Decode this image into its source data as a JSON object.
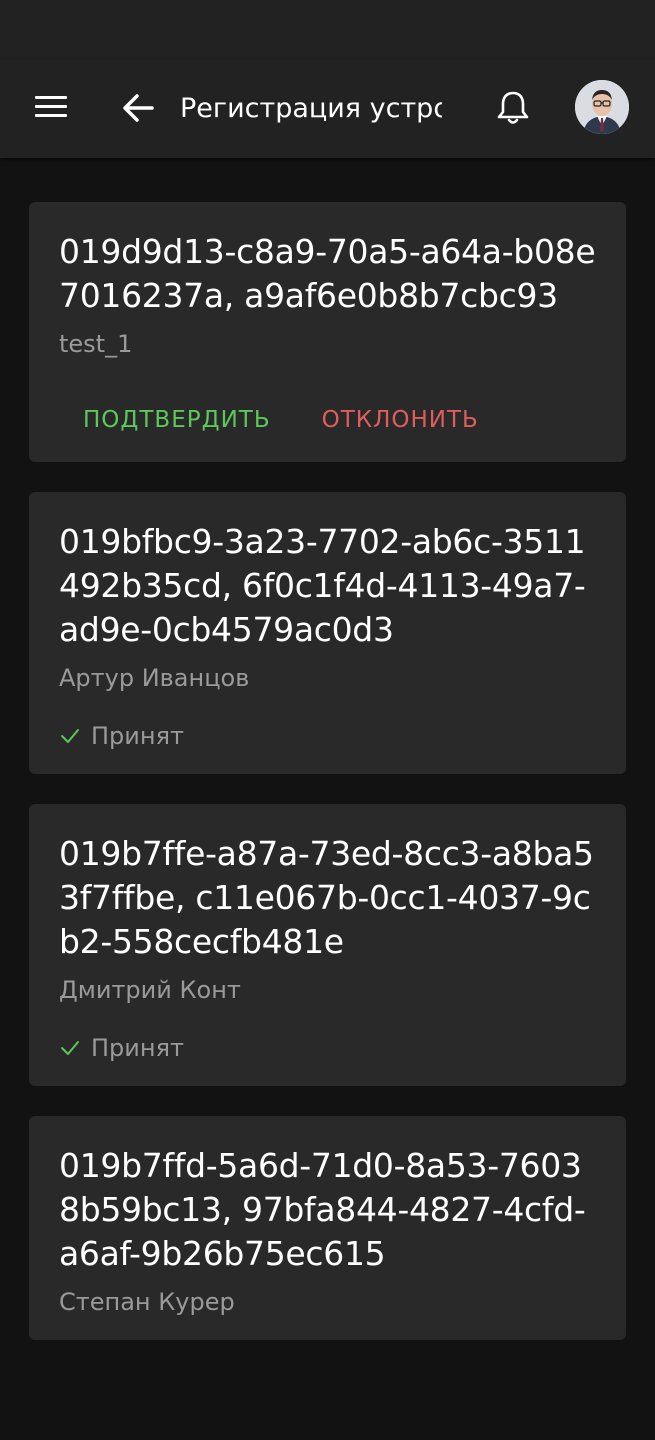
{
  "header": {
    "title": "Регистрация устройств"
  },
  "colors": {
    "confirm": "#5cc85a",
    "reject": "#e05d5d",
    "status_accepted": "#5cc85a"
  },
  "icons": {
    "menu": "menu-icon",
    "back": "arrow-left-icon",
    "notifications": "bell-icon",
    "avatar": "user-avatar"
  },
  "devices": [
    {
      "id": "019d9d13-c8a9-70a5-a64a-b08e7016237a, a9af6e0b8b7cbc93",
      "owner": "test_1",
      "confirm_label": "ПОДТВЕРДИТЬ",
      "reject_label": "ОТКЛОНИТЬ"
    },
    {
      "id": "019bfbc9-3a23-7702-ab6c-3511492b35cd, 6f0c1f4d-4113-49a7-ad9e-0cb4579ac0d3",
      "owner": "Артур Иванцов",
      "status": "Принят"
    },
    {
      "id": "019b7ffe-a87a-73ed-8cc3-a8ba53f7ffbe, c11e067b-0cc1-4037-9cb2-558cecfb481e",
      "owner": "Дмитрий Конт",
      "status": "Принят"
    },
    {
      "id": "019b7ffd-5a6d-71d0-8a53-76038b59bc13, 97bfa844-4827-4cfd-a6af-9b26b75ec615",
      "owner": "Степан Курер"
    }
  ]
}
